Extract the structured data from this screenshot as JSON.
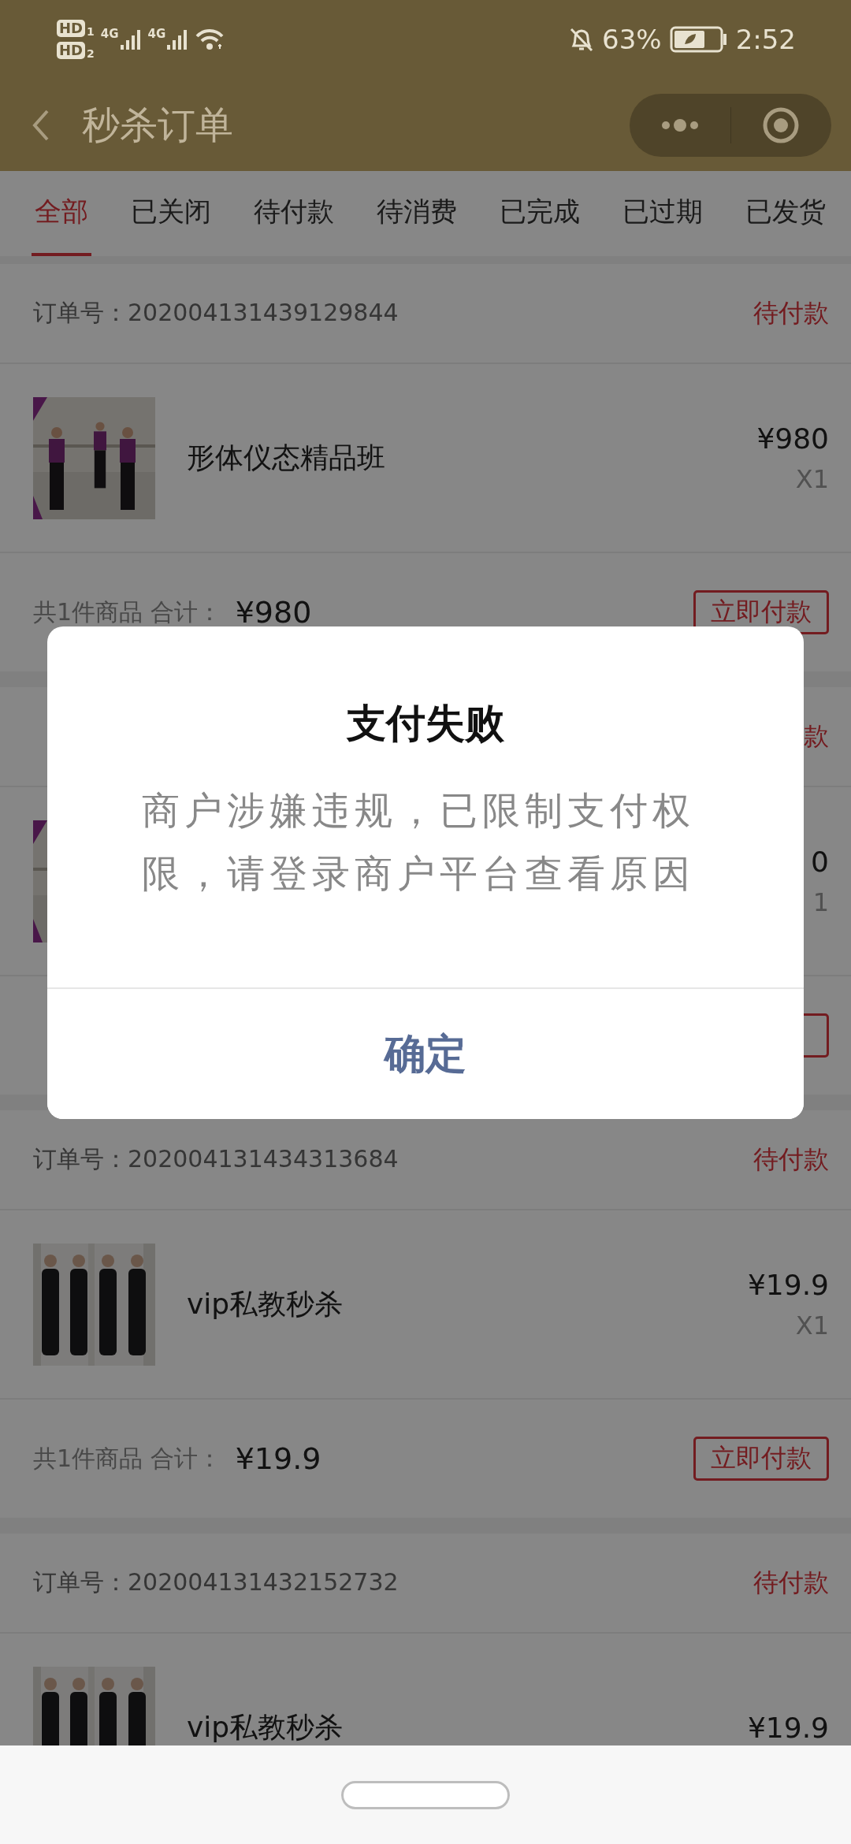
{
  "status_bar": {
    "sims": [
      {
        "hd": "HD",
        "slot": "1",
        "network": "4G"
      },
      {
        "hd": "HD",
        "slot": "2",
        "network": "4G"
      }
    ],
    "battery": "63%",
    "time": "2:52"
  },
  "nav": {
    "title": "秒杀订单"
  },
  "tabs": [
    {
      "label": "全部",
      "selected": true
    },
    {
      "label": "已关闭",
      "selected": false
    },
    {
      "label": "待付款",
      "selected": false
    },
    {
      "label": "待消费",
      "selected": false
    },
    {
      "label": "已完成",
      "selected": false
    },
    {
      "label": "已过期",
      "selected": false
    },
    {
      "label": "已发货",
      "selected": false
    }
  ],
  "orders": [
    {
      "order_no": "订单号：202004131439129844",
      "status": "待付款",
      "items": [
        {
          "name": "形体仪态精品班",
          "price": "¥980",
          "qty": "X1"
        }
      ],
      "summary": "共1件商品 合计：",
      "total": "¥980",
      "action_button": true,
      "action": "立即付款"
    },
    {
      "status": "款",
      "items": [
        {
          "price": "0",
          "qty": "1"
        }
      ],
      "action_button": true
    },
    {
      "order_no": "订单号：202004131434313684",
      "status": "待付款",
      "items": [
        {
          "name": "vip私教秒杀",
          "price": "¥19.9",
          "qty": "X1"
        }
      ],
      "summary": "共1件商品 合计：",
      "total": "¥19.9",
      "action_button": true,
      "action": "立即付款"
    },
    {
      "order_no": "订单号：202004131432152732",
      "status": "待付款",
      "items": [
        {
          "name": "vip私教秒杀",
          "price": "¥19.9"
        }
      ],
      "action_button": false
    }
  ],
  "dialog": {
    "title": "支付失败",
    "message": "商户涉嫌违规，已限制支付权限，请登录商户平台查看原因",
    "button": "确定"
  }
}
